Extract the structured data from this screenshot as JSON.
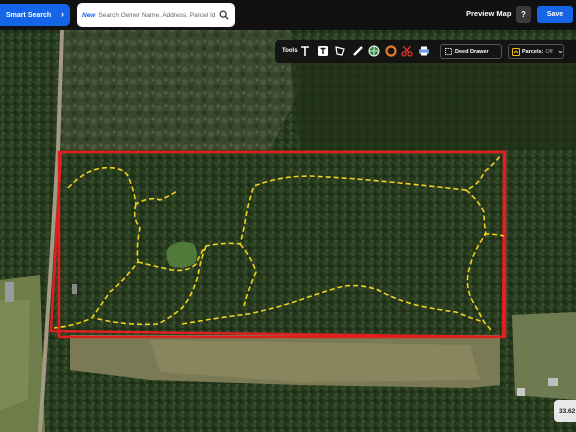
{
  "topbar": {
    "smart_search_label": "Smart Search",
    "search_badge": "New",
    "search_placeholder": "Search Owner Name, Address, Parcel Id",
    "preview_map_label": "Preview Map",
    "help_label": "?",
    "save_label": "Save"
  },
  "toolsbar": {
    "tools_label": "Tools",
    "tools": [
      "text-icon",
      "text-box-icon",
      "polygon-icon",
      "ruler-icon",
      "globe-icon",
      "circle-icon",
      "scissors-icon",
      "print-icon"
    ],
    "deed_drawer_label": "Deed Drawer",
    "parcels_label": "Parcels:",
    "parcels_state": "Off"
  },
  "map": {
    "acreage_label": "33.62",
    "parcel_boundary_color": "#e02020",
    "trail_color": "#f2d21b"
  }
}
